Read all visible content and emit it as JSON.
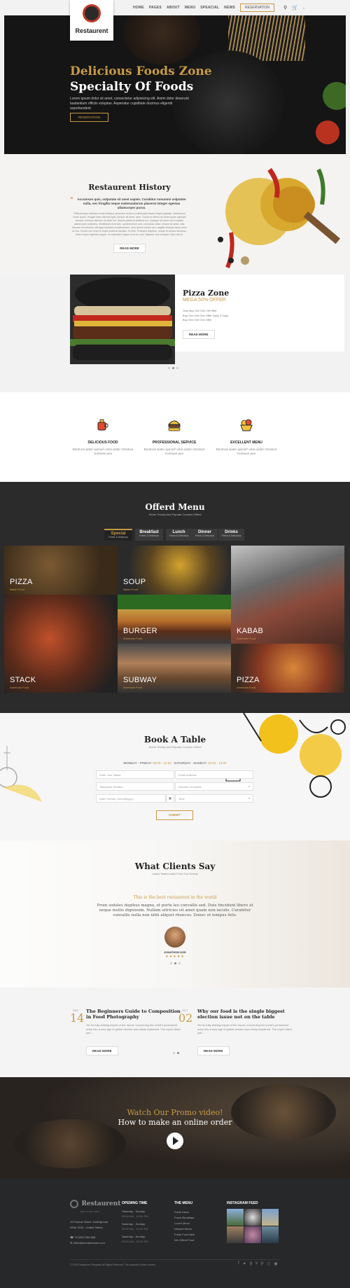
{
  "header": {
    "logo_text": "Restaurent",
    "nav": [
      "HOME",
      "PAGES",
      "ABOUT",
      "MENU",
      "SPEACIAL",
      "NEWS"
    ],
    "reservation": "RESERVATION",
    "cart_count": "0"
  },
  "hero": {
    "title_line1": "Delicious Foods Zone",
    "title_line2": "Specialty Of Foods",
    "text": "Lorem ipsum dolor sit amet, consectetur adipisicing elit. Animi dolor deserunt laudantium officiis voluptas. Asperiatur cupiditate ducimus eligendi reprehenderit",
    "button": "RESERVATION"
  },
  "history": {
    "title": "Restaurent History",
    "quote": "Accumsan quis, vulputate sit amet sapien. Curabitur nonummi vulputate nulla, nec fringilla neque malesuadarum placerat integer egestas ullamcorper purus.",
    "text": "Pellentesque habitant morbi tristique senectus netus et malesuada fames turpis egestas. Vestibulum tortor quam, feugiat vitae ultricies eget, tempor sit amet, ante. Donec eu libero sit amet quam egestas semper. Aenean ultricies mi vitae est. Mauris placerat eleifend leo. Quisque sit amet est et sapien ullamcorper pharetra. Vestibulum erat wisi, condimentum sed, commodo vitae, ornare sit amet, wisi. Aenean fermentum, elit eget tincidunt condimentum, eros ipsum rutrum orci, sagittis tempus lacus enim ac dui. Donec non enim in turpis pulvinar facilisis. Ut felis. Praesent dapibus, neque id cursus faucibus, tortor neque egestas augue, eu vulputate magna eros eu erat. Aliquam erat volutpat. Nam dui mi, tincidunt quis, accumsan porttitor, facilisis luctus, metus. Phasellus ultrices nulla quis nibh. Quisque a lectus. Donec consectetuer ligula vulputate sem tristique cursus. Nam nulla quam, gravida non, commodo a, sodales sit amet, nisi. Pellentesque fermentum dolor. Aliquam quam lectus, facilisis auctor, ultrices ut, elementum vulputate, nunc.",
    "button": "READ MORE"
  },
  "pizza": {
    "title": "Pizza Zone",
    "offer": "MEGA 50% OFFER",
    "items": [
      "Only Buy Get One Off Offer",
      "Buy One Get One Offer Daily 2 Days",
      "Buy One Get One Offer"
    ],
    "button": "READ MORE"
  },
  "features": [
    {
      "title": "DELICIOUS FOOD",
      "text": "Beetroot water spinach okra water chestnut ricebean pea"
    },
    {
      "title": "PROFESSIONAL SERVICE",
      "text": "Beetroot water spinach okra water chestnut ricebean pea"
    },
    {
      "title": "EXCELLENT MENU",
      "text": "Beetroot water spinach okra water chestnut ricebean pea"
    }
  ],
  "menu": {
    "title": "Offerd Menu",
    "subtitle": "Some Trendy And Popular Courses Offerd",
    "tabs": [
      {
        "label": "Special",
        "sub": "Fresh & Delicious"
      },
      {
        "label": "Breakfast",
        "sub": "Fresh & Delicious"
      },
      {
        "label": "Lunch",
        "sub": "Fresh & Delicious"
      },
      {
        "label": "Dinner",
        "sub": "Fresh & Delicious"
      },
      {
        "label": "Drinks",
        "sub": "Fresh & Delicious"
      }
    ],
    "tiles": [
      {
        "name": "PIZZA",
        "sub": "Italian Food"
      },
      {
        "name": "SOUP",
        "sub": "Italian Food"
      },
      {
        "name": "BURGER",
        "sub": "American Food"
      },
      {
        "name": "KABAB",
        "sub": "American Food"
      },
      {
        "name": "STACK",
        "sub": "American Food"
      },
      {
        "name": "SUBWAY",
        "sub": "American Food"
      },
      {
        "name": "PIZZA",
        "sub": "American Food"
      }
    ]
  },
  "booking": {
    "title": "Book A Table",
    "subtitle": "Some Trendy And Popular Courses Offerd",
    "hours_weekday_label": "MONDAY - FRIDAY:",
    "hours_weekday": "08:00 - 22:00",
    "hours_weekend_label": "SATURDAY - SUNDAY:",
    "hours_weekend": "10:00 - 18:00",
    "name_placeholder": "Enter Your Name",
    "email_placeholder": "Email Address",
    "phone_placeholder": "Telephone Number",
    "guests_placeholder": "Number of Guests",
    "date_placeholder": "Date Format ( mm/dd/yyyy )",
    "time_placeholder": "Time",
    "submit": "SUBMIT"
  },
  "testimonials": {
    "title": "What Clients Say",
    "subtitle": "Latest Testimonials From Our Guests",
    "headline": "This is the best restaurent in the world",
    "quote": "Proin sodales dapibus magna, et porta leo convallis sed. Duis tincidunt libero at neque mollis dignissim. Nullam ultricies sit amet quam non iaculis. Curabitur convallis nulla non nibh aliquet rhoncus. Donec et tempus felis.",
    "author": "JONATHON DOE",
    "rating": 5
  },
  "blog": [
    {
      "month": "DEC",
      "day": "14",
      "title": "The Beginners Guide to Composition in Food Photography",
      "text": "Yet he fully striking import of the report, concerning the world's permanent entry into a new age of global desires was newly explained. The report didn't just ...",
      "button": "READ MORE"
    },
    {
      "month": "OCT",
      "day": "02",
      "title": "Why our food is the single biggest election issue not on the table",
      "text": "Yet he fully striking import of the report, concerning the world's permanent entry into a new age of global desires was newly explained. The report didn't just ...",
      "button": "READ MORE"
    }
  ],
  "promo": {
    "line1": "Watch Our Promo video!",
    "line2": "How to make an online order"
  },
  "footer": {
    "logo_text": "Restaurent",
    "logo_tagline": "BEST FOOD ZONE",
    "address": [
      "15 Francis Street, Darlinghurst",
      "NSW 2010 , United States"
    ],
    "phone": "+0 0000 555 888",
    "email": "office@domainname.com",
    "opening_title": "OPENING TIME",
    "opening": [
      {
        "days": "Saturday - Sunday",
        "time": "09:00 AM - 10:00 PM"
      },
      {
        "days": "Saturday - Sunday",
        "time": "09:00 AM - 10:00 PM"
      },
      {
        "days": "Saturday - Sunday",
        "time": "09:00 AM - 10:00 PM"
      }
    ],
    "menu_title": "THE MENU",
    "menu_items": [
      "Fresh Menu",
      "Fresh Breakfast",
      "Lunch Menu",
      "Dessert Menu",
      "Fresh Food Item",
      "We Offerd Food"
    ],
    "instagram_title": "INSTAGRAM FEED",
    "copyright": "© 2020 Restaurent Template All Rights Reserved. The property of their owners."
  },
  "colors": {
    "accent": "#c79b45",
    "dark": "#2b2b2b",
    "footer": "#262829"
  }
}
